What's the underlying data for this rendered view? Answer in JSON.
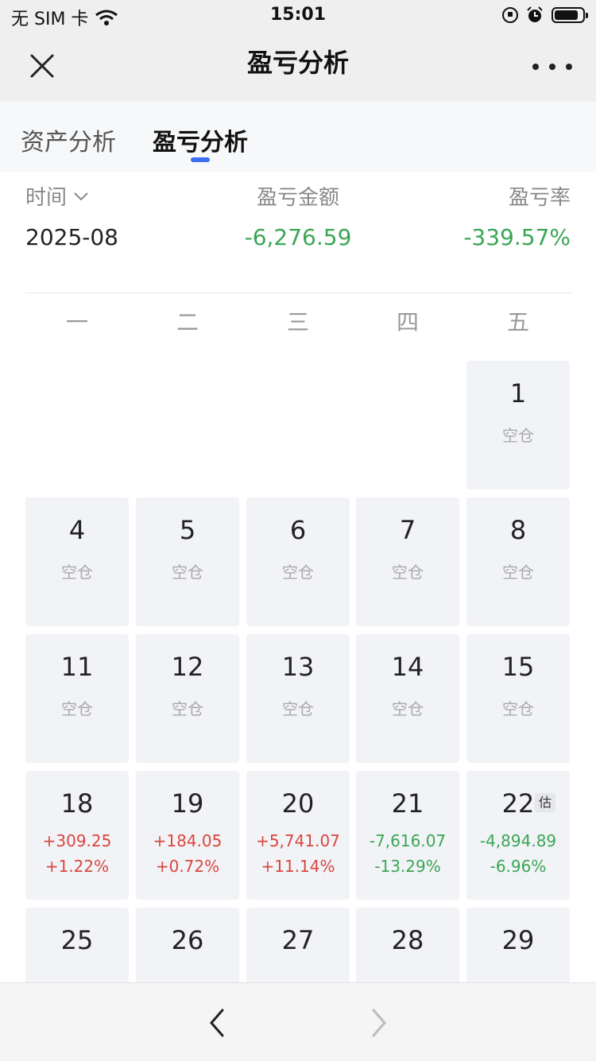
{
  "status_bar": {
    "carrier": "无 SIM 卡",
    "time": "15:01",
    "battery_level": 0.85
  },
  "nav": {
    "title": "盈亏分析"
  },
  "tabs": [
    {
      "label": "资产分析",
      "active": false
    },
    {
      "label": "盈亏分析",
      "active": true
    }
  ],
  "summary": {
    "time_label": "时间",
    "time_value": "2025-08",
    "amount_label": "盈亏金额",
    "amount_value": "-6,276.59",
    "rate_label": "盈亏率",
    "rate_value": "-339.57%"
  },
  "weekdays": [
    "一",
    "二",
    "三",
    "四",
    "五"
  ],
  "calendar": {
    "days": [
      {
        "day": "1",
        "status": "空仓"
      },
      {
        "day": "4",
        "status": "空仓"
      },
      {
        "day": "5",
        "status": "空仓"
      },
      {
        "day": "6",
        "status": "空仓"
      },
      {
        "day": "7",
        "status": "空仓"
      },
      {
        "day": "8",
        "status": "空仓"
      },
      {
        "day": "11",
        "status": "空仓"
      },
      {
        "day": "12",
        "status": "空仓"
      },
      {
        "day": "13",
        "status": "空仓"
      },
      {
        "day": "14",
        "status": "空仓"
      },
      {
        "day": "15",
        "status": "空仓"
      },
      {
        "day": "18",
        "amount": "+309.25",
        "pct": "+1.22%",
        "trend": "up"
      },
      {
        "day": "19",
        "amount": "+184.05",
        "pct": "+0.72%",
        "trend": "up"
      },
      {
        "day": "20",
        "amount": "+5,741.07",
        "pct": "+11.14%",
        "trend": "up"
      },
      {
        "day": "21",
        "amount": "-7,616.07",
        "pct": "-13.29%",
        "trend": "down"
      },
      {
        "day": "22",
        "amount": "-4,894.89",
        "pct": "-6.96%",
        "trend": "down",
        "badge": "估"
      },
      {
        "day": "25"
      },
      {
        "day": "26"
      },
      {
        "day": "27"
      },
      {
        "day": "28"
      },
      {
        "day": "29"
      }
    ]
  },
  "colors": {
    "gain": "#d9463f",
    "loss": "#3aa655",
    "accent": "#3b6ef0"
  }
}
